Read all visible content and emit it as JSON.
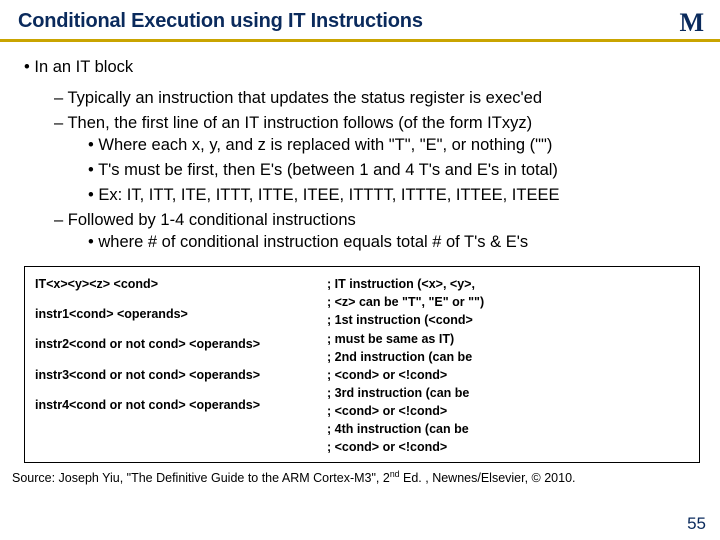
{
  "title": "Conditional Execution using IT Instructions",
  "logo_text": "M",
  "main_bullet": "In an IT block",
  "sub": {
    "a": "Typically an instruction that updates the status register is exec'ed",
    "b": "Then, the first line of an IT instruction follows (of the form ITxyz)",
    "b1": "Where each x, y, and z is replaced with \"T\", \"E\", or nothing (\"\")",
    "b2": "T's must be first, then E's (between 1 and 4 T's and E's in total)",
    "b3": "Ex: IT, ITT, ITE, ITTT, ITTE, ITEE, ITTTT, ITTTE, ITTEE, ITEEE",
    "c": "Followed by 1-4 conditional instructions",
    "c1": "where # of conditional instruction equals total # of T's & E's"
  },
  "code_left": {
    "l1": "IT<x><y><z> <cond>",
    "l2": "instr1<cond> <operands>",
    "l3": "instr2<cond or not cond> <operands>",
    "l4": "instr3<cond or not cond> <operands>",
    "l5": "instr4<cond or not cond> <operands>"
  },
  "code_right": {
    "r1": "; IT instruction (<x>, <y>,",
    "r2": "; <z> can be \"T\", \"E\" or \"\")",
    "r3": "; 1st instruction (<cond>",
    "r4": "; must be same as IT)",
    "r5": "; 2nd instruction (can be",
    "r6": "; <cond> or <!cond>",
    "r7": "; 3rd instruction (can be",
    "r8": "; <cond> or <!cond>",
    "r9": "; 4th instruction (can be",
    "r10": "; <cond> or <!cond>"
  },
  "source_prefix": "Source: Joseph Yiu, \"The Definitive Guide to the ARM Cortex-M3\", 2",
  "source_sup": "nd",
  "source_suffix": " Ed. , Newnes/Elsevier, © 2010.",
  "page_number": "55"
}
